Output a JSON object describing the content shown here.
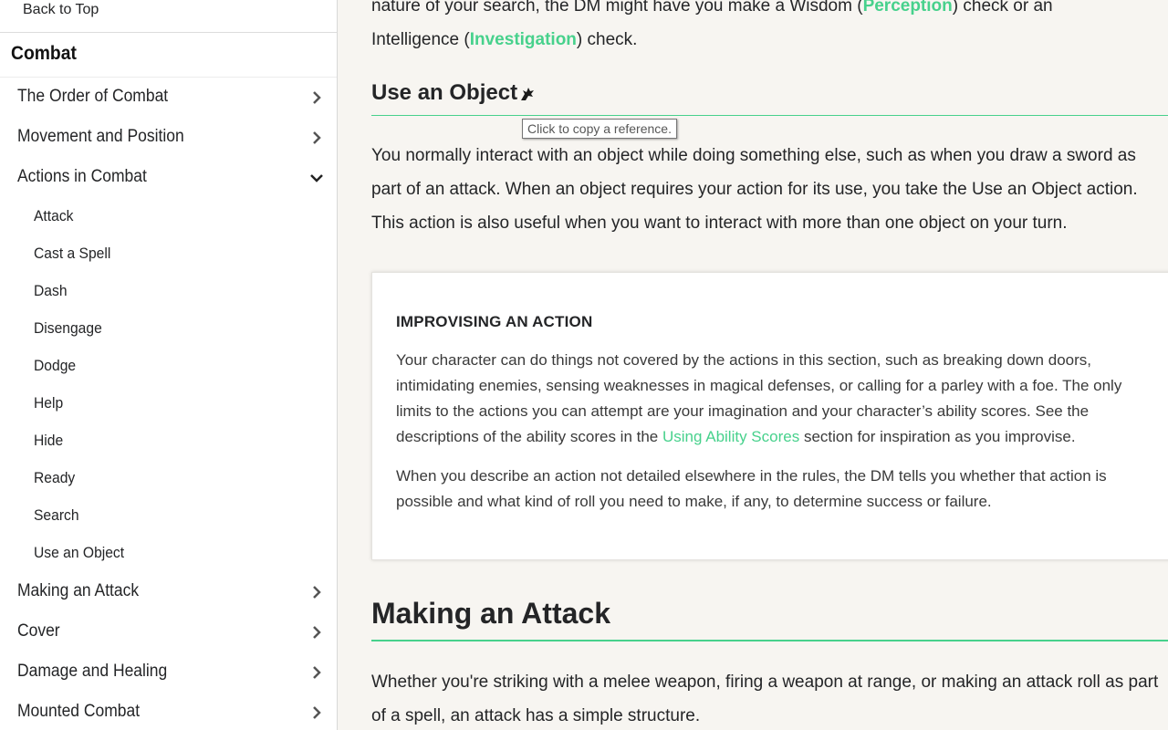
{
  "sidebar": {
    "back_to_top": "Back to Top",
    "section_title": "Combat",
    "items": [
      {
        "label": "The Order of Combat",
        "chevron": "chevron-right-icon"
      },
      {
        "label": "Movement and Position",
        "chevron": "chevron-right-icon"
      },
      {
        "label": "Actions in Combat",
        "chevron": "chevron-down-icon"
      }
    ],
    "sub_items": [
      {
        "label": "Attack"
      },
      {
        "label": "Cast a Spell"
      },
      {
        "label": "Dash"
      },
      {
        "label": "Disengage"
      },
      {
        "label": "Dodge"
      },
      {
        "label": "Help"
      },
      {
        "label": "Hide"
      },
      {
        "label": "Ready"
      },
      {
        "label": "Search"
      },
      {
        "label": "Use an Object"
      }
    ],
    "items_after": [
      {
        "label": "Making an Attack",
        "chevron": "chevron-right-icon"
      },
      {
        "label": "Cover",
        "chevron": "chevron-right-icon"
      },
      {
        "label": "Damage and Healing",
        "chevron": "chevron-right-icon"
      },
      {
        "label": "Mounted Combat",
        "chevron": "chevron-right-icon"
      }
    ]
  },
  "main": {
    "intro_line1_a": "nature of your search, the DM might have you make a Wisdom (",
    "intro_link_perception": "Perception",
    "intro_line1_b": ") check or an",
    "intro_line2_a": "Intelligence (",
    "intro_link_investigation": "Investigation",
    "intro_line2_b": ") check.",
    "use_object_heading": "Use an Object",
    "tooltip": "Click to copy a reference.",
    "use_object_body": "You normally interact with an object while doing something else, such as when you draw a sword as part of an attack. When an object requires your action for its use, you take the Use an Object action. This action is also useful when you want to interact with more than one object on your turn.",
    "sidebox": {
      "title": "IMPROVISING AN ACTION",
      "p1_a": "Your character can do things not covered by the actions in this section, such as breaking down doors, intimidating enemies, sensing weaknesses in magical defenses, or calling for a parley with a foe. The only limits to the actions you can attempt are your imagination and your character’s ability scores. See the descriptions of the ability scores in the ",
      "p1_link": "Using Ability Scores",
      "p1_b": " section for inspiration as you improvise.",
      "p2": "When you describe an action not detailed elsewhere in the rules, the DM tells you whether that action is possible and what kind of roll you need to make, if any, to determine success or failure."
    },
    "making_attack_heading": "Making an Attack",
    "making_attack_body": "Whether you're striking with a melee weapon, firing a weapon at range, or making an attack roll as part of a spell, an attack has a simple structure."
  },
  "colors": {
    "accent": "#47d18c",
    "text": "#242527",
    "background": "#f7f5f1"
  },
  "icons": {
    "heading_link": "dragon-link-icon"
  }
}
